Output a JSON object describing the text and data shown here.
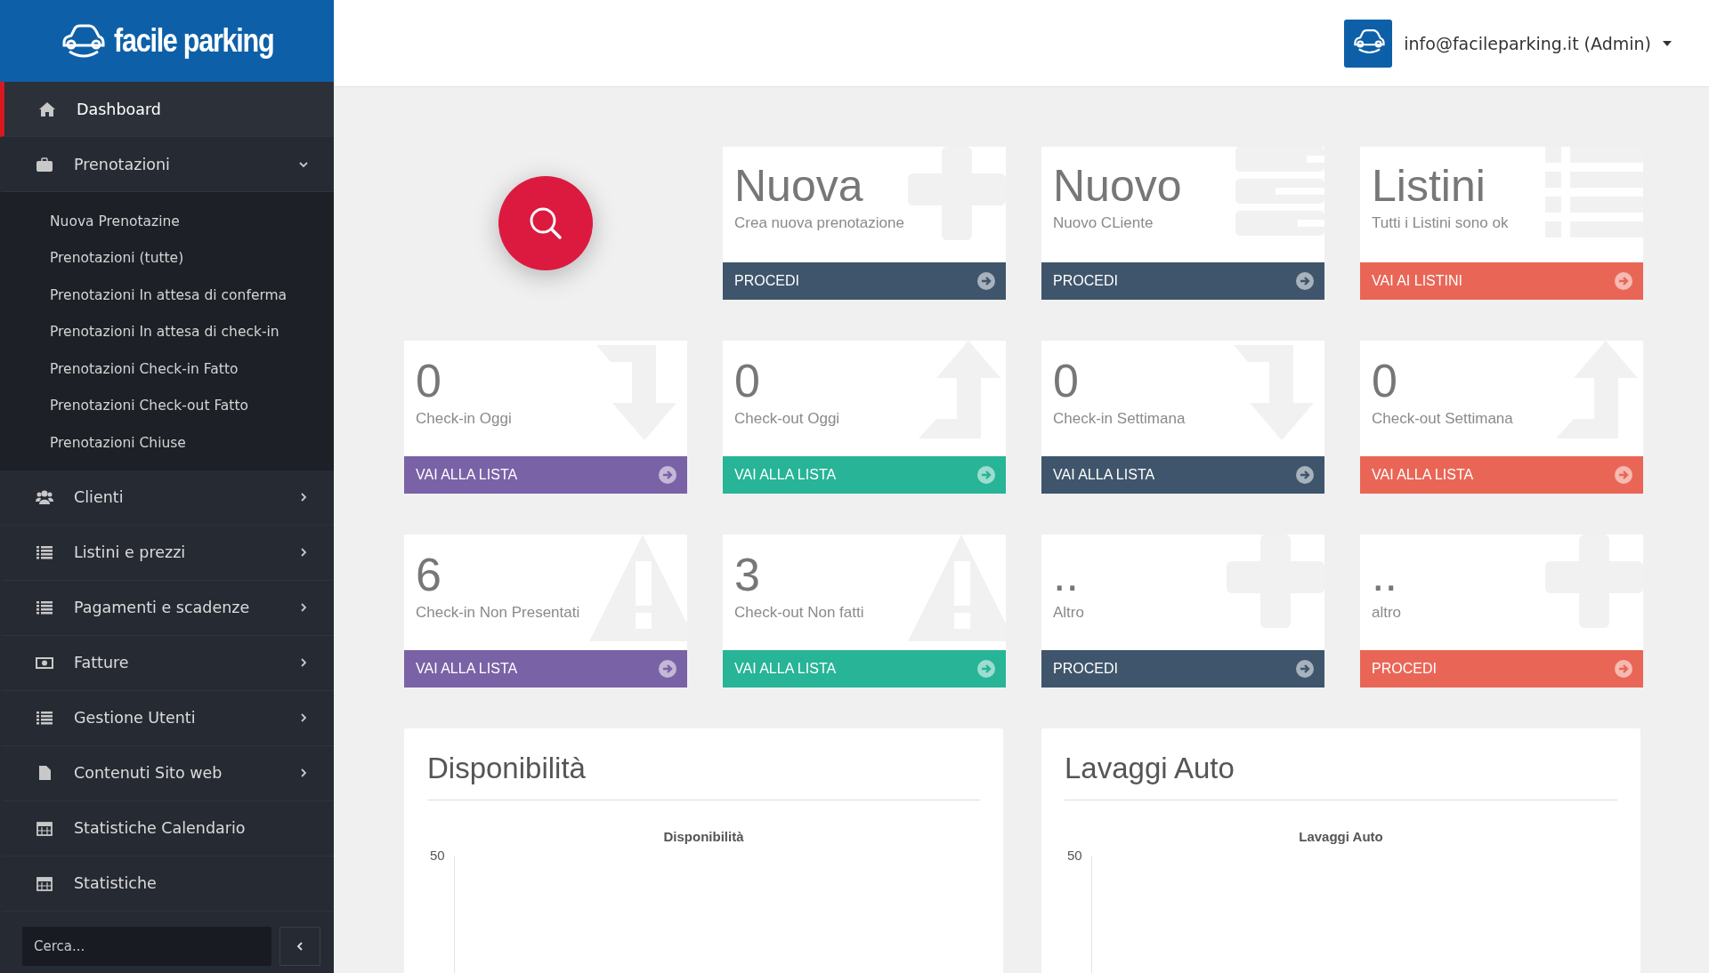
{
  "brand": {
    "name": "facile parking"
  },
  "sidebar": {
    "items": [
      {
        "label": "Dashboard",
        "kind": "home",
        "selected": true
      },
      {
        "label": "Prenotazioni",
        "kind": "briefcase",
        "selected": false,
        "expanded": true,
        "children": [
          {
            "label": "Nuova Prenotazine"
          },
          {
            "label": "Prenotazioni (tutte)"
          },
          {
            "label": "Prenotazioni In attesa di conferma"
          },
          {
            "label": "Prenotazioni In attesa di check-in"
          },
          {
            "label": "Prenotazioni Check-in Fatto"
          },
          {
            "label": "Prenotazioni Check-out Fatto"
          },
          {
            "label": "Prenotazioni Chiuse"
          }
        ]
      },
      {
        "label": "Clienti",
        "kind": "users",
        "selected": false,
        "expanded": false
      },
      {
        "label": "Listini e prezzi",
        "kind": "list",
        "selected": false,
        "expanded": false
      },
      {
        "label": "Pagamenti e scadenze",
        "kind": "list",
        "selected": false,
        "expanded": false
      },
      {
        "label": "Fatture",
        "kind": "money",
        "selected": false,
        "expanded": false
      },
      {
        "label": "Gestione Utenti",
        "kind": "list",
        "selected": false,
        "expanded": false
      },
      {
        "label": "Contenuti Sito web",
        "kind": "file",
        "selected": false,
        "expanded": false
      },
      {
        "label": "Statistiche Calendario",
        "kind": "calendar",
        "selected": false
      },
      {
        "label": "Statistiche",
        "kind": "calendar",
        "selected": false
      }
    ],
    "search": {
      "placeholder": "Cerca..."
    }
  },
  "topbar": {
    "user": "info@facileparking.it (Admin)"
  },
  "cards": [
    {
      "title": "Nuova",
      "subtitle": "Crea nuova prenotazione",
      "action": "PROCEDI",
      "color": "#3f556b",
      "kind": "plus"
    },
    {
      "title": "Nuovo",
      "subtitle": "Nuovo CLiente",
      "action": "PROCEDI",
      "color": "#3f556b",
      "kind": "form"
    },
    {
      "title": "Listini",
      "subtitle": "Tutti i Listini sono ok",
      "action": "VAI AI LISTINI",
      "color": "#e96656",
      "kind": "list"
    },
    {
      "title": "0",
      "subtitle": "Check-in Oggi",
      "action": "VAI ALLA LISTA",
      "color": "#7a62a6",
      "kind": "down"
    },
    {
      "title": "0",
      "subtitle": "Check-out Oggi",
      "action": "VAI ALLA LISTA",
      "color": "#27b497",
      "kind": "up"
    },
    {
      "title": "0",
      "subtitle": "Check-in Settimana",
      "action": "VAI ALLA LISTA",
      "color": "#3f556b",
      "kind": "down"
    },
    {
      "title": "0",
      "subtitle": "Check-out Settimana",
      "action": "VAI ALLA LISTA",
      "color": "#e96656",
      "kind": "up"
    },
    {
      "title": "6",
      "subtitle": "Check-in Non Presentati",
      "action": "VAI ALLA LISTA",
      "color": "#7a62a6",
      "kind": "warning"
    },
    {
      "title": "3",
      "subtitle": "Check-out Non fatti",
      "action": "VAI ALLA LISTA",
      "color": "#27b497",
      "kind": "warning"
    },
    {
      "title": "..",
      "subtitle": "Altro",
      "action": "PROCEDI",
      "color": "#3f556b",
      "kind": "plus"
    },
    {
      "title": "..",
      "subtitle": "altro",
      "action": "PROCEDI",
      "color": "#e96656",
      "kind": "plus"
    }
  ],
  "panels": [
    {
      "title": "Disponibilità",
      "chart_title": "Disponibilità",
      "ytick": "50"
    },
    {
      "title": "Lavaggi Auto",
      "chart_title": "Lavaggi Auto",
      "ytick": "50"
    }
  ]
}
